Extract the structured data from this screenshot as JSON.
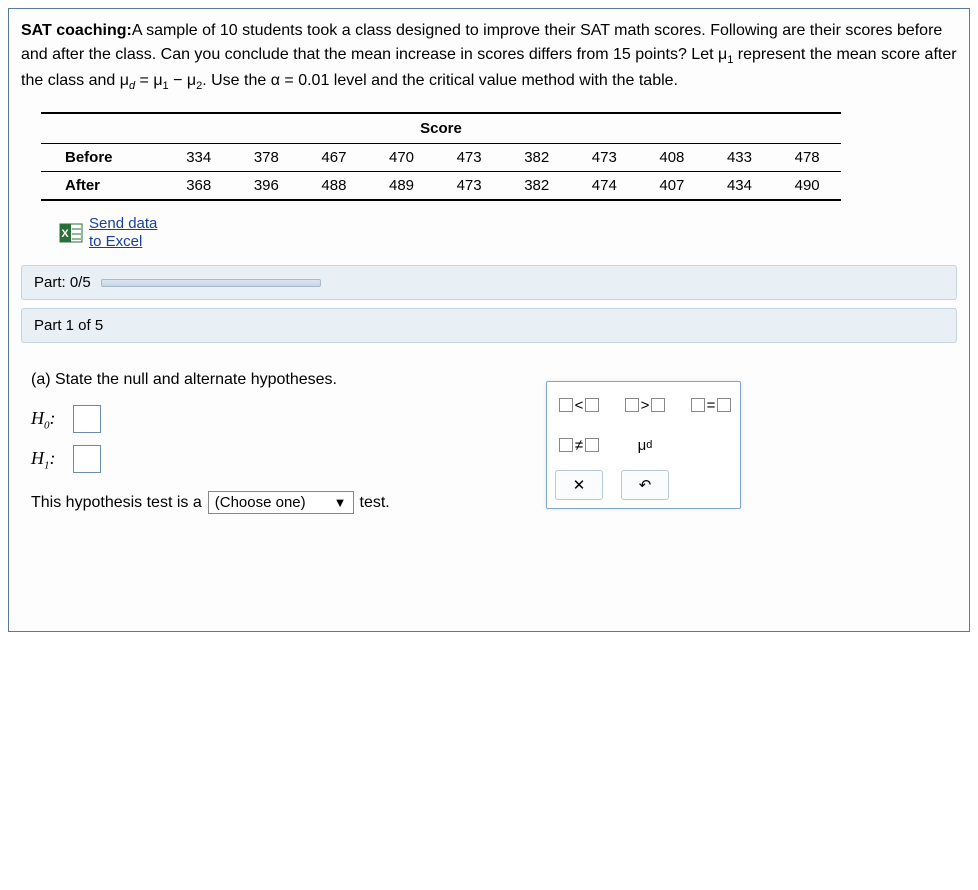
{
  "problem": {
    "title_bold": "SAT coaching:",
    "line1a": "A sample of ",
    "sample_n": "10",
    "line1b": " students took a class designed to improve their SAT math scores. Following are their scores before and after the class. Can you conclude that the mean increase in scores differs from ",
    "diff_points": "15",
    "line1c": " points? Let ",
    "mu1_text": "μ",
    "mu1_sub": "1",
    "line1d": " represent the mean score after the class and ",
    "mud_text": "μ",
    "mud_sub": "d",
    "eq_text": " = μ",
    "eq_sub1": "1",
    "minus_text": " − μ",
    "eq_sub2": "2",
    "line1e": ". Use the ",
    "alpha_text": "α = 0.01",
    "line1f": " level and the critical value method with the table."
  },
  "chart_data": {
    "type": "table",
    "title": "Score",
    "rows": [
      {
        "label": "Before",
        "values": [
          334,
          378,
          467,
          470,
          473,
          382,
          473,
          408,
          433,
          478
        ]
      },
      {
        "label": "After",
        "values": [
          368,
          396,
          488,
          489,
          473,
          382,
          474,
          407,
          434,
          490
        ]
      }
    ]
  },
  "send_data": {
    "line1": "Send data",
    "line2": "to Excel"
  },
  "progress": {
    "label": "Part: 0/5"
  },
  "part_header": "Part 1 of 5",
  "question_a": "(a) State the null and alternate hypotheses.",
  "hypotheses": {
    "h0_label": "H",
    "h0_sub": "0",
    "colon": ":",
    "h1_label": "H",
    "h1_sub": "1"
  },
  "sentence": {
    "pre": "This hypothesis test is a ",
    "dropdown": "(Choose one)",
    "post": " test."
  },
  "palette": {
    "lt": "<",
    "gt": ">",
    "eq": "=",
    "ne": "≠",
    "mud": "μ",
    "mud_sub": "d",
    "close": "✕",
    "undo": "↶"
  }
}
